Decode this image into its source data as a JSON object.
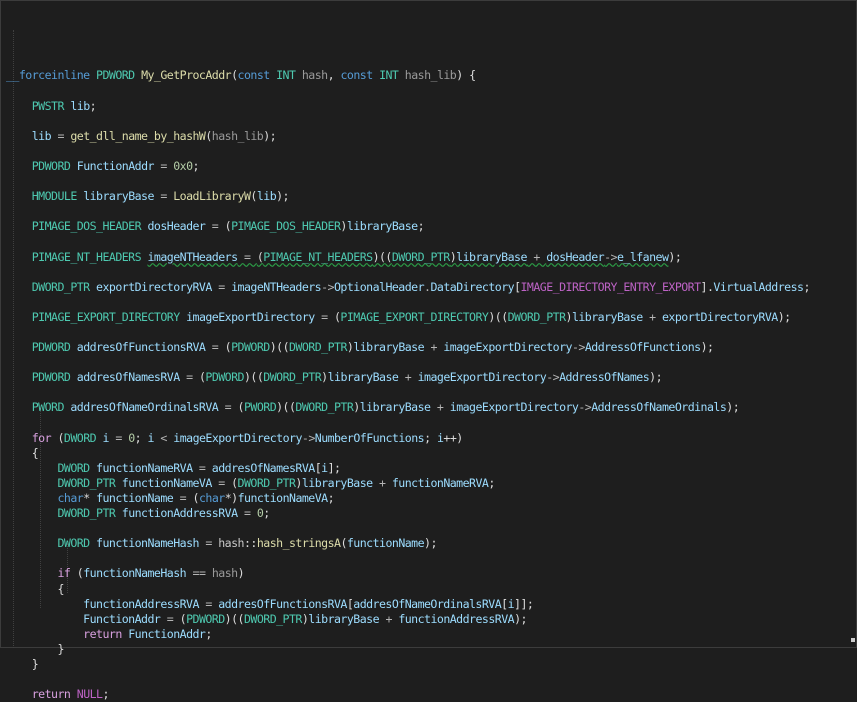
{
  "editor": {
    "lines": [
      [
        {
          "t": "__forceinline",
          "c": "kw"
        },
        {
          "t": " ",
          "c": "pl"
        },
        {
          "t": "PDWORD",
          "c": "ty"
        },
        {
          "t": " ",
          "c": "pl"
        },
        {
          "t": "My_GetProcAddr",
          "c": "fn"
        },
        {
          "t": "(",
          "c": "pl"
        },
        {
          "t": "const",
          "c": "kw"
        },
        {
          "t": " ",
          "c": "pl"
        },
        {
          "t": "INT",
          "c": "ty"
        },
        {
          "t": " ",
          "c": "pl"
        },
        {
          "t": "hash",
          "c": "prm"
        },
        {
          "t": ", ",
          "c": "pl"
        },
        {
          "t": "const",
          "c": "kw"
        },
        {
          "t": " ",
          "c": "pl"
        },
        {
          "t": "INT",
          "c": "ty"
        },
        {
          "t": " ",
          "c": "pl"
        },
        {
          "t": "hash_lib",
          "c": "prm"
        },
        {
          "t": ") {",
          "c": "pl"
        }
      ],
      [],
      [
        {
          "t": "    ",
          "c": "pl"
        },
        {
          "t": "PWSTR",
          "c": "ty"
        },
        {
          "t": " ",
          "c": "pl"
        },
        {
          "t": "lib",
          "c": "var"
        },
        {
          "t": ";",
          "c": "pl"
        }
      ],
      [],
      [
        {
          "t": "    ",
          "c": "pl"
        },
        {
          "t": "lib",
          "c": "var"
        },
        {
          "t": " = ",
          "c": "op"
        },
        {
          "t": "get_dll_name_by_hashW",
          "c": "fn"
        },
        {
          "t": "(",
          "c": "pl"
        },
        {
          "t": "hash_lib",
          "c": "prm"
        },
        {
          "t": ");",
          "c": "pl"
        }
      ],
      [],
      [
        {
          "t": "    ",
          "c": "pl"
        },
        {
          "t": "PDWORD",
          "c": "ty"
        },
        {
          "t": " ",
          "c": "pl"
        },
        {
          "t": "FunctionAddr",
          "c": "var"
        },
        {
          "t": " = ",
          "c": "op"
        },
        {
          "t": "0x0",
          "c": "num"
        },
        {
          "t": ";",
          "c": "pl"
        }
      ],
      [],
      [
        {
          "t": "    ",
          "c": "pl"
        },
        {
          "t": "HMODULE",
          "c": "ty"
        },
        {
          "t": " ",
          "c": "pl"
        },
        {
          "t": "libraryBase",
          "c": "var"
        },
        {
          "t": " = ",
          "c": "op"
        },
        {
          "t": "LoadLibraryW",
          "c": "fn"
        },
        {
          "t": "(",
          "c": "pl"
        },
        {
          "t": "lib",
          "c": "var"
        },
        {
          "t": ");",
          "c": "pl"
        }
      ],
      [],
      [
        {
          "t": "    ",
          "c": "pl"
        },
        {
          "t": "PIMAGE_DOS_HEADER",
          "c": "ty"
        },
        {
          "t": " ",
          "c": "pl"
        },
        {
          "t": "dosHeader",
          "c": "var"
        },
        {
          "t": " = ",
          "c": "op"
        },
        {
          "t": "(",
          "c": "pl"
        },
        {
          "t": "PIMAGE_DOS_HEADER",
          "c": "ty"
        },
        {
          "t": ")",
          "c": "pl"
        },
        {
          "t": "libraryBase",
          "c": "var"
        },
        {
          "t": ";",
          "c": "pl"
        }
      ],
      [],
      [
        {
          "t": "    ",
          "c": "pl"
        },
        {
          "t": "PIMAGE_NT_HEADERS",
          "c": "ty"
        },
        {
          "t": " ",
          "c": "pl"
        },
        {
          "t": "imageNTHeaders",
          "c": "var squig"
        },
        {
          "t": " = ",
          "c": "op squig"
        },
        {
          "t": "(",
          "c": "pl squig"
        },
        {
          "t": "PIMAGE_NT_HEADERS",
          "c": "ty squig"
        },
        {
          "t": ")((",
          "c": "pl squig"
        },
        {
          "t": "DWORD_PTR",
          "c": "ty squig"
        },
        {
          "t": ")",
          "c": "pl squig"
        },
        {
          "t": "libraryBase",
          "c": "var squig"
        },
        {
          "t": " + ",
          "c": "op squig"
        },
        {
          "t": "dosHeader",
          "c": "var squig"
        },
        {
          "t": "->",
          "c": "op squig"
        },
        {
          "t": "e_lfanew",
          "c": "var squig"
        },
        {
          "t": ");",
          "c": "pl"
        }
      ],
      [],
      [
        {
          "t": "    ",
          "c": "pl"
        },
        {
          "t": "DWORD_PTR",
          "c": "ty"
        },
        {
          "t": " ",
          "c": "pl"
        },
        {
          "t": "exportDirectoryRVA",
          "c": "var"
        },
        {
          "t": " = ",
          "c": "op"
        },
        {
          "t": "imageNTHeaders",
          "c": "var"
        },
        {
          "t": "->",
          "c": "op"
        },
        {
          "t": "OptionalHeader",
          "c": "var"
        },
        {
          "t": ".",
          "c": "op"
        },
        {
          "t": "DataDirectory",
          "c": "var"
        },
        {
          "t": "[",
          "c": "pl"
        },
        {
          "t": "IMAGE_DIRECTORY_ENTRY_EXPORT",
          "c": "mac"
        },
        {
          "t": "].",
          "c": "pl"
        },
        {
          "t": "VirtualAddress",
          "c": "var"
        },
        {
          "t": ";",
          "c": "pl"
        }
      ],
      [],
      [
        {
          "t": "    ",
          "c": "pl"
        },
        {
          "t": "PIMAGE_EXPORT_DIRECTORY",
          "c": "ty"
        },
        {
          "t": " ",
          "c": "pl"
        },
        {
          "t": "imageExportDirectory",
          "c": "var"
        },
        {
          "t": " = ",
          "c": "op"
        },
        {
          "t": "(",
          "c": "pl"
        },
        {
          "t": "PIMAGE_EXPORT_DIRECTORY",
          "c": "ty"
        },
        {
          "t": ")((",
          "c": "pl"
        },
        {
          "t": "DWORD_PTR",
          "c": "ty"
        },
        {
          "t": ")",
          "c": "pl"
        },
        {
          "t": "libraryBase",
          "c": "var"
        },
        {
          "t": " + ",
          "c": "op"
        },
        {
          "t": "exportDirectoryRVA",
          "c": "var"
        },
        {
          "t": ");",
          "c": "pl"
        }
      ],
      [],
      [
        {
          "t": "    ",
          "c": "pl"
        },
        {
          "t": "PDWORD",
          "c": "ty"
        },
        {
          "t": " ",
          "c": "pl"
        },
        {
          "t": "addresOfFunctionsRVA",
          "c": "var"
        },
        {
          "t": " = ",
          "c": "op"
        },
        {
          "t": "(",
          "c": "pl"
        },
        {
          "t": "PDWORD",
          "c": "ty"
        },
        {
          "t": ")((",
          "c": "pl"
        },
        {
          "t": "DWORD_PTR",
          "c": "ty"
        },
        {
          "t": ")",
          "c": "pl"
        },
        {
          "t": "libraryBase",
          "c": "var"
        },
        {
          "t": " + ",
          "c": "op"
        },
        {
          "t": "imageExportDirectory",
          "c": "var"
        },
        {
          "t": "->",
          "c": "op"
        },
        {
          "t": "AddressOfFunctions",
          "c": "var"
        },
        {
          "t": ");",
          "c": "pl"
        }
      ],
      [],
      [
        {
          "t": "    ",
          "c": "pl"
        },
        {
          "t": "PDWORD",
          "c": "ty"
        },
        {
          "t": " ",
          "c": "pl"
        },
        {
          "t": "addresOfNamesRVA",
          "c": "var"
        },
        {
          "t": " = ",
          "c": "op"
        },
        {
          "t": "(",
          "c": "pl"
        },
        {
          "t": "PDWORD",
          "c": "ty"
        },
        {
          "t": ")((",
          "c": "pl"
        },
        {
          "t": "DWORD_PTR",
          "c": "ty"
        },
        {
          "t": ")",
          "c": "pl"
        },
        {
          "t": "libraryBase",
          "c": "var"
        },
        {
          "t": " + ",
          "c": "op"
        },
        {
          "t": "imageExportDirectory",
          "c": "var"
        },
        {
          "t": "->",
          "c": "op"
        },
        {
          "t": "AddressOfNames",
          "c": "var"
        },
        {
          "t": ");",
          "c": "pl"
        }
      ],
      [],
      [
        {
          "t": "    ",
          "c": "pl"
        },
        {
          "t": "PWORD",
          "c": "ty"
        },
        {
          "t": " ",
          "c": "pl"
        },
        {
          "t": "addresOfNameOrdinalsRVA",
          "c": "var"
        },
        {
          "t": " = ",
          "c": "op"
        },
        {
          "t": "(",
          "c": "pl"
        },
        {
          "t": "PWORD",
          "c": "ty"
        },
        {
          "t": ")((",
          "c": "pl"
        },
        {
          "t": "DWORD_PTR",
          "c": "ty"
        },
        {
          "t": ")",
          "c": "pl"
        },
        {
          "t": "libraryBase",
          "c": "var"
        },
        {
          "t": " + ",
          "c": "op"
        },
        {
          "t": "imageExportDirectory",
          "c": "var"
        },
        {
          "t": "->",
          "c": "op"
        },
        {
          "t": "AddressOfNameOrdinals",
          "c": "var"
        },
        {
          "t": ");",
          "c": "pl"
        }
      ],
      [],
      [
        {
          "t": "    ",
          "c": "pl"
        },
        {
          "t": "for",
          "c": "ctl"
        },
        {
          "t": " (",
          "c": "pl"
        },
        {
          "t": "DWORD",
          "c": "ty"
        },
        {
          "t": " ",
          "c": "pl"
        },
        {
          "t": "i",
          "c": "var"
        },
        {
          "t": " = ",
          "c": "op"
        },
        {
          "t": "0",
          "c": "num"
        },
        {
          "t": "; ",
          "c": "pl"
        },
        {
          "t": "i",
          "c": "var"
        },
        {
          "t": " < ",
          "c": "op"
        },
        {
          "t": "imageExportDirectory",
          "c": "var"
        },
        {
          "t": "->",
          "c": "op"
        },
        {
          "t": "NumberOfFunctions",
          "c": "var"
        },
        {
          "t": "; ",
          "c": "pl"
        },
        {
          "t": "i",
          "c": "var"
        },
        {
          "t": "++)",
          "c": "pl"
        }
      ],
      [
        {
          "t": "    {",
          "c": "pl"
        }
      ],
      [
        {
          "t": "        ",
          "c": "pl"
        },
        {
          "t": "DWORD",
          "c": "ty"
        },
        {
          "t": " ",
          "c": "pl"
        },
        {
          "t": "functionNameRVA",
          "c": "var"
        },
        {
          "t": " = ",
          "c": "op"
        },
        {
          "t": "addresOfNamesRVA",
          "c": "var"
        },
        {
          "t": "[",
          "c": "pl"
        },
        {
          "t": "i",
          "c": "var"
        },
        {
          "t": "];",
          "c": "pl"
        }
      ],
      [
        {
          "t": "        ",
          "c": "pl"
        },
        {
          "t": "DWORD_PTR",
          "c": "ty"
        },
        {
          "t": " ",
          "c": "pl"
        },
        {
          "t": "functionNameVA",
          "c": "var"
        },
        {
          "t": " = ",
          "c": "op"
        },
        {
          "t": "(",
          "c": "pl"
        },
        {
          "t": "DWORD_PTR",
          "c": "ty"
        },
        {
          "t": ")",
          "c": "pl"
        },
        {
          "t": "libraryBase",
          "c": "var"
        },
        {
          "t": " + ",
          "c": "op"
        },
        {
          "t": "functionNameRVA",
          "c": "var"
        },
        {
          "t": ";",
          "c": "pl"
        }
      ],
      [
        {
          "t": "        ",
          "c": "pl"
        },
        {
          "t": "char",
          "c": "kw"
        },
        {
          "t": "* ",
          "c": "pl"
        },
        {
          "t": "functionName",
          "c": "var"
        },
        {
          "t": " = ",
          "c": "op"
        },
        {
          "t": "(",
          "c": "pl"
        },
        {
          "t": "char",
          "c": "kw"
        },
        {
          "t": "*)",
          "c": "pl"
        },
        {
          "t": "functionNameVA",
          "c": "var"
        },
        {
          "t": ";",
          "c": "pl"
        }
      ],
      [
        {
          "t": "        ",
          "c": "pl"
        },
        {
          "t": "DWORD_PTR",
          "c": "ty"
        },
        {
          "t": " ",
          "c": "pl"
        },
        {
          "t": "functionAddressRVA",
          "c": "var"
        },
        {
          "t": " = ",
          "c": "op"
        },
        {
          "t": "0",
          "c": "num"
        },
        {
          "t": ";",
          "c": "pl"
        }
      ],
      [],
      [
        {
          "t": "        ",
          "c": "pl"
        },
        {
          "t": "DWORD",
          "c": "ty"
        },
        {
          "t": " ",
          "c": "pl"
        },
        {
          "t": "functionNameHash",
          "c": "var"
        },
        {
          "t": " = ",
          "c": "op"
        },
        {
          "t": "hash",
          "c": "ns"
        },
        {
          "t": "::",
          "c": "pl"
        },
        {
          "t": "hash_stringsA",
          "c": "fn"
        },
        {
          "t": "(",
          "c": "pl"
        },
        {
          "t": "functionName",
          "c": "var"
        },
        {
          "t": ");",
          "c": "pl"
        }
      ],
      [],
      [
        {
          "t": "        ",
          "c": "pl"
        },
        {
          "t": "if",
          "c": "ctl"
        },
        {
          "t": " (",
          "c": "pl"
        },
        {
          "t": "functionNameHash",
          "c": "var"
        },
        {
          "t": " == ",
          "c": "op"
        },
        {
          "t": "hash",
          "c": "prm"
        },
        {
          "t": ")",
          "c": "pl"
        }
      ],
      [
        {
          "t": "        {",
          "c": "pl"
        }
      ],
      [
        {
          "t": "            ",
          "c": "pl"
        },
        {
          "t": "functionAddressRVA",
          "c": "var"
        },
        {
          "t": " = ",
          "c": "op"
        },
        {
          "t": "addresOfFunctionsRVA",
          "c": "var"
        },
        {
          "t": "[",
          "c": "pl"
        },
        {
          "t": "addresOfNameOrdinalsRVA",
          "c": "var"
        },
        {
          "t": "[",
          "c": "pl"
        },
        {
          "t": "i",
          "c": "var"
        },
        {
          "t": "]];",
          "c": "pl"
        }
      ],
      [
        {
          "t": "            ",
          "c": "pl"
        },
        {
          "t": "FunctionAddr",
          "c": "var"
        },
        {
          "t": " = ",
          "c": "op"
        },
        {
          "t": "(",
          "c": "pl"
        },
        {
          "t": "PDWORD",
          "c": "ty"
        },
        {
          "t": ")((",
          "c": "pl"
        },
        {
          "t": "DWORD_PTR",
          "c": "ty"
        },
        {
          "t": ")",
          "c": "pl"
        },
        {
          "t": "libraryBase",
          "c": "var"
        },
        {
          "t": " + ",
          "c": "op"
        },
        {
          "t": "functionAddressRVA",
          "c": "var"
        },
        {
          "t": ");",
          "c": "pl"
        }
      ],
      [
        {
          "t": "            ",
          "c": "pl"
        },
        {
          "t": "return",
          "c": "ctl"
        },
        {
          "t": " ",
          "c": "pl"
        },
        {
          "t": "FunctionAddr",
          "c": "var"
        },
        {
          "t": ";",
          "c": "pl"
        }
      ],
      [
        {
          "t": "        }",
          "c": "pl"
        }
      ],
      [
        {
          "t": "    }",
          "c": "pl"
        }
      ],
      [],
      [
        {
          "t": "    ",
          "c": "pl"
        },
        {
          "t": "return",
          "c": "ctl"
        },
        {
          "t": " ",
          "c": "pl"
        },
        {
          "t": "NULL",
          "c": "mac"
        },
        {
          "t": ";",
          "c": "pl"
        }
      ]
    ]
  },
  "colors": {
    "background": "#1e1e1e",
    "keyword": "#569cd6",
    "control": "#d8a0df",
    "type": "#4ec9b0",
    "function": "#dcdcaa",
    "variable": "#9cdcfe",
    "macro": "#bd63c5",
    "number": "#b5cea8",
    "squiggle": "#2b9a45"
  }
}
